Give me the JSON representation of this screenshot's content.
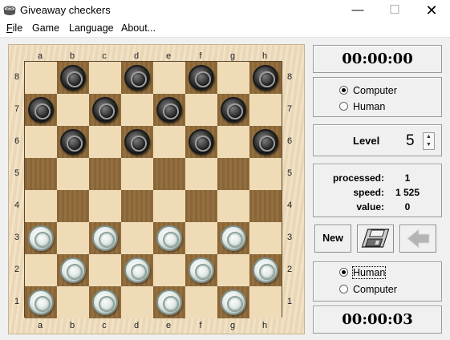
{
  "window": {
    "title": "Giveaway checkers"
  },
  "menu": [
    "File",
    "Game",
    "Language",
    "About..."
  ],
  "board": {
    "files": [
      "a",
      "b",
      "c",
      "d",
      "e",
      "f",
      "g",
      "h"
    ],
    "ranks": [
      "8",
      "7",
      "6",
      "5",
      "4",
      "3",
      "2",
      "1"
    ],
    "pieces": [
      {
        "sq": "b8",
        "color": "black"
      },
      {
        "sq": "d8",
        "color": "black"
      },
      {
        "sq": "f8",
        "color": "black"
      },
      {
        "sq": "h8",
        "color": "black"
      },
      {
        "sq": "a7",
        "color": "black"
      },
      {
        "sq": "c7",
        "color": "black"
      },
      {
        "sq": "e7",
        "color": "black"
      },
      {
        "sq": "g7",
        "color": "black"
      },
      {
        "sq": "b6",
        "color": "black"
      },
      {
        "sq": "d6",
        "color": "black"
      },
      {
        "sq": "f6",
        "color": "black"
      },
      {
        "sq": "h6",
        "color": "black"
      },
      {
        "sq": "a3",
        "color": "white"
      },
      {
        "sq": "c3",
        "color": "white"
      },
      {
        "sq": "e3",
        "color": "white"
      },
      {
        "sq": "g3",
        "color": "white"
      },
      {
        "sq": "b2",
        "color": "white"
      },
      {
        "sq": "d2",
        "color": "white"
      },
      {
        "sq": "f2",
        "color": "white"
      },
      {
        "sq": "h2",
        "color": "white"
      },
      {
        "sq": "a1",
        "color": "white"
      },
      {
        "sq": "c1",
        "color": "white"
      },
      {
        "sq": "e1",
        "color": "white"
      },
      {
        "sq": "g1",
        "color": "white"
      }
    ]
  },
  "top_timer": "00:00:00",
  "top_player": {
    "options": [
      "Computer",
      "Human"
    ],
    "selected": "Computer"
  },
  "level": {
    "label": "Level",
    "value": "5"
  },
  "stats": [
    {
      "name": "processed:",
      "value": "1"
    },
    {
      "name": "speed:",
      "value": "1 525"
    },
    {
      "name": "value:",
      "value": "0"
    }
  ],
  "buttons": {
    "new": "New",
    "save_icon": "floppy-disk-icon",
    "undo_icon": "arrow-left-icon"
  },
  "bottom_player": {
    "options": [
      "Human",
      "Computer"
    ],
    "selected": "Human"
  },
  "bottom_timer": "00:00:03"
}
